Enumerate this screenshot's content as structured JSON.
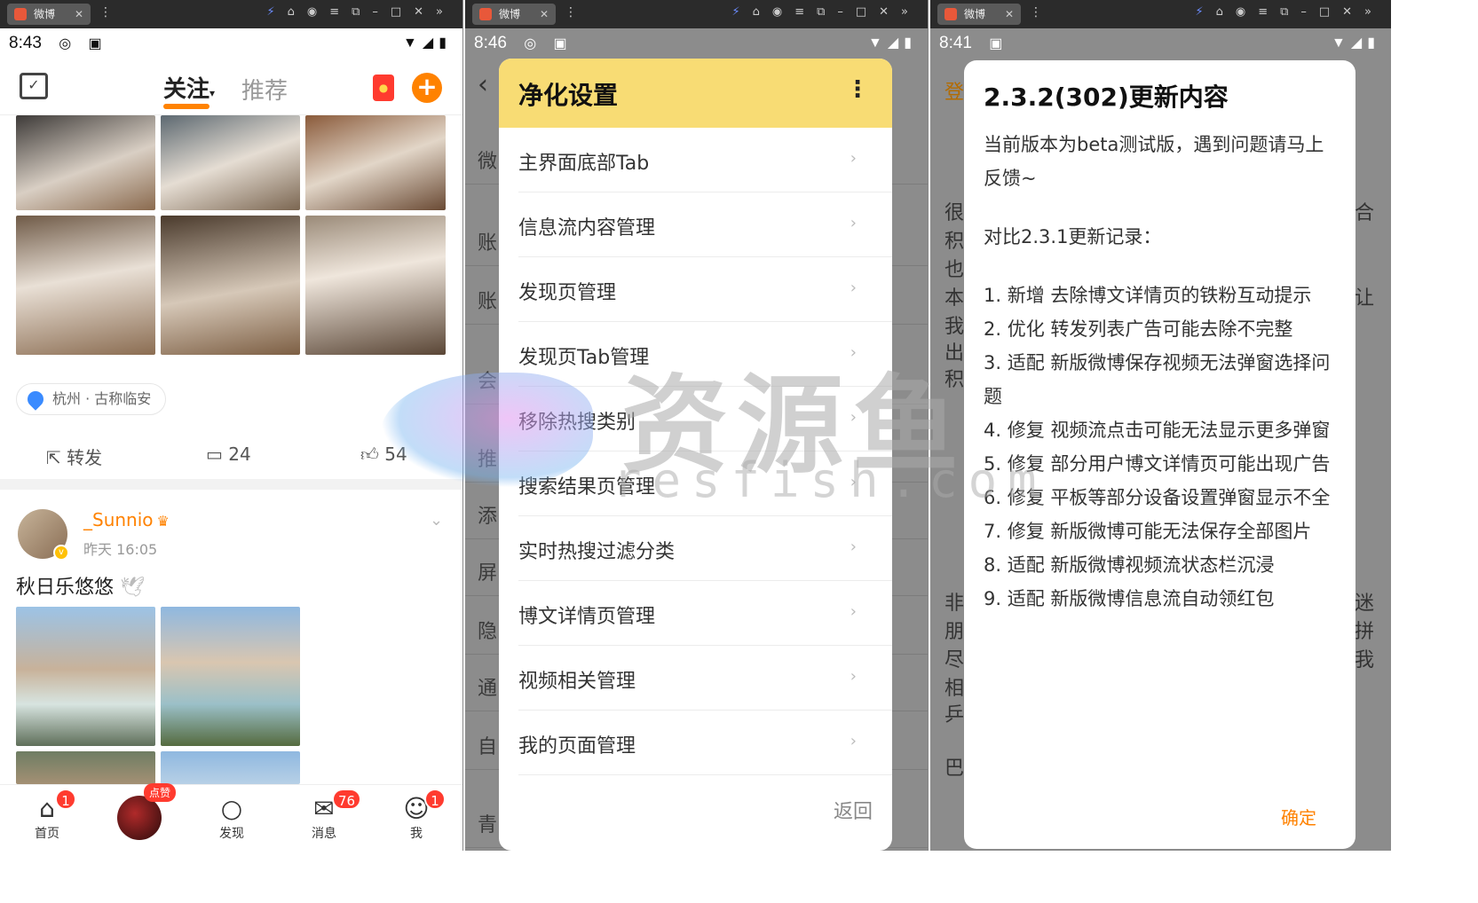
{
  "panel1": {
    "tab_label": "微博",
    "status": {
      "time": "8:43"
    },
    "header": {
      "tab_follow": "关注",
      "tab_recommend": "推荐"
    },
    "location": "杭州 · 古称临安",
    "actions": {
      "repost": "转发",
      "comments": "24",
      "likes": "54"
    },
    "post": {
      "username": "_Sunnio",
      "time": "昨天 16:05",
      "text": "秋日乐悠悠"
    },
    "hot_badge": "点赞",
    "nav": [
      {
        "label": "首页",
        "badge": "1"
      },
      {
        "label": "发现",
        "badge": ""
      },
      {
        "label": "消息",
        "badge": "76"
      },
      {
        "label": "我",
        "badge": "1"
      }
    ]
  },
  "panel2": {
    "tab_label": "微博",
    "status": {
      "time": "8:46"
    },
    "dialog_title": "净化设置",
    "menu": [
      "主界面底部Tab",
      "信息流内容管理",
      "发现页管理",
      "发现页Tab管理",
      "移除热搜类别",
      "搜索结果页管理",
      "实时热搜过滤分类",
      "博文详情页管理",
      "视频相关管理",
      "我的页面管理"
    ],
    "back_label": "返回",
    "bg_chars": [
      "微",
      "账",
      "账",
      "会",
      "推",
      "添",
      "屏",
      "隐",
      "通",
      "自",
      "青"
    ]
  },
  "panel3": {
    "tab_label": "微博",
    "status": {
      "time": "8:41"
    },
    "title": "2.3.2(302)更新内容",
    "intro": "当前版本为beta测试版，遇到问题请马上反馈~",
    "compare": "对比2.3.1更新记录：",
    "items": [
      "1. 新增 去除博文详情页的铁粉互动提示",
      "2. 优化 转发列表广告可能去除不完整",
      "3. 适配 新版微博保存视频无法弹窗选择问题",
      "4. 修复 视频流点击可能无法显示更多弹窗",
      "5. 修复 部分用户博文详情页可能出现广告",
      "6. 修复 平板等部分设备设置弹窗显示不全",
      "7. 修复 新版微博可能无法保存全部图片",
      "8. 适配 新版微博视频流状态栏沉浸",
      "9. 适配 新版微博信息流自动领红包"
    ],
    "confirm": "确定",
    "bg_chars_left": [
      "登",
      "很",
      "积",
      "也",
      "本",
      "我",
      "出",
      "积",
      "非",
      "朋",
      "尽",
      "相",
      "乒",
      "巴"
    ],
    "bg_chars_right": [
      "合",
      "让",
      "迷",
      "拼",
      "我"
    ]
  },
  "watermark": {
    "main": "资源鱼",
    "sub": "resfish.com"
  },
  "colors": {
    "accent": "#ff8200",
    "dialog_header": "#f8dc74",
    "badge": "#ff3b2f"
  }
}
